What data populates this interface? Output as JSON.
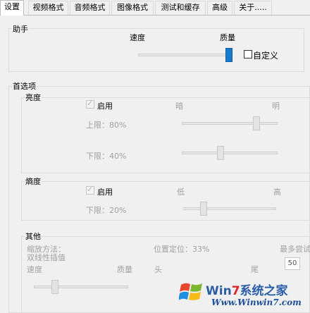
{
  "tabs": [
    {
      "label": "设置",
      "active": true
    },
    {
      "label": "视频格式"
    },
    {
      "label": "音频格式"
    },
    {
      "label": "图像格式"
    },
    {
      "label": "测试和缓存"
    },
    {
      "label": "高级"
    },
    {
      "label": "关于....."
    }
  ],
  "assistant": {
    "title": "助手",
    "speed_label": "速度",
    "quality_label": "质量",
    "custom_label": "自定义",
    "custom_checked": false,
    "slider_level": 1.0
  },
  "preferences": {
    "title": "首选项",
    "brightness": {
      "title": "亮度",
      "enable_label": "启用",
      "enabled": true,
      "dark_label": "暗",
      "bright_label": "明",
      "upper_label": "上限：80%",
      "upper_value": 80,
      "lower_label": "下限：40%",
      "lower_value": 40
    },
    "entropy": {
      "title": "熵度",
      "enable_label": "启用",
      "enabled": true,
      "low_label": "低",
      "high_label": "高",
      "lower_label": "下限：20%",
      "lower_value": 20
    },
    "other": {
      "title": "其他",
      "scale_method_label": "缩放方法：",
      "scale_method_value": "双线性插值",
      "speed_label": "速度",
      "quality_label": "质量",
      "position_label": "位置定位：33%",
      "position_value": 33,
      "head_label": "头",
      "tail_label": "尾",
      "max_attempts_label": "最多尝试",
      "max_attempts_value": "50"
    }
  },
  "watermark": {
    "title_prefix": "Win",
    "title_seven": "7",
    "title_cn": "系统之家",
    "url": "Www.Winwin7.com"
  }
}
